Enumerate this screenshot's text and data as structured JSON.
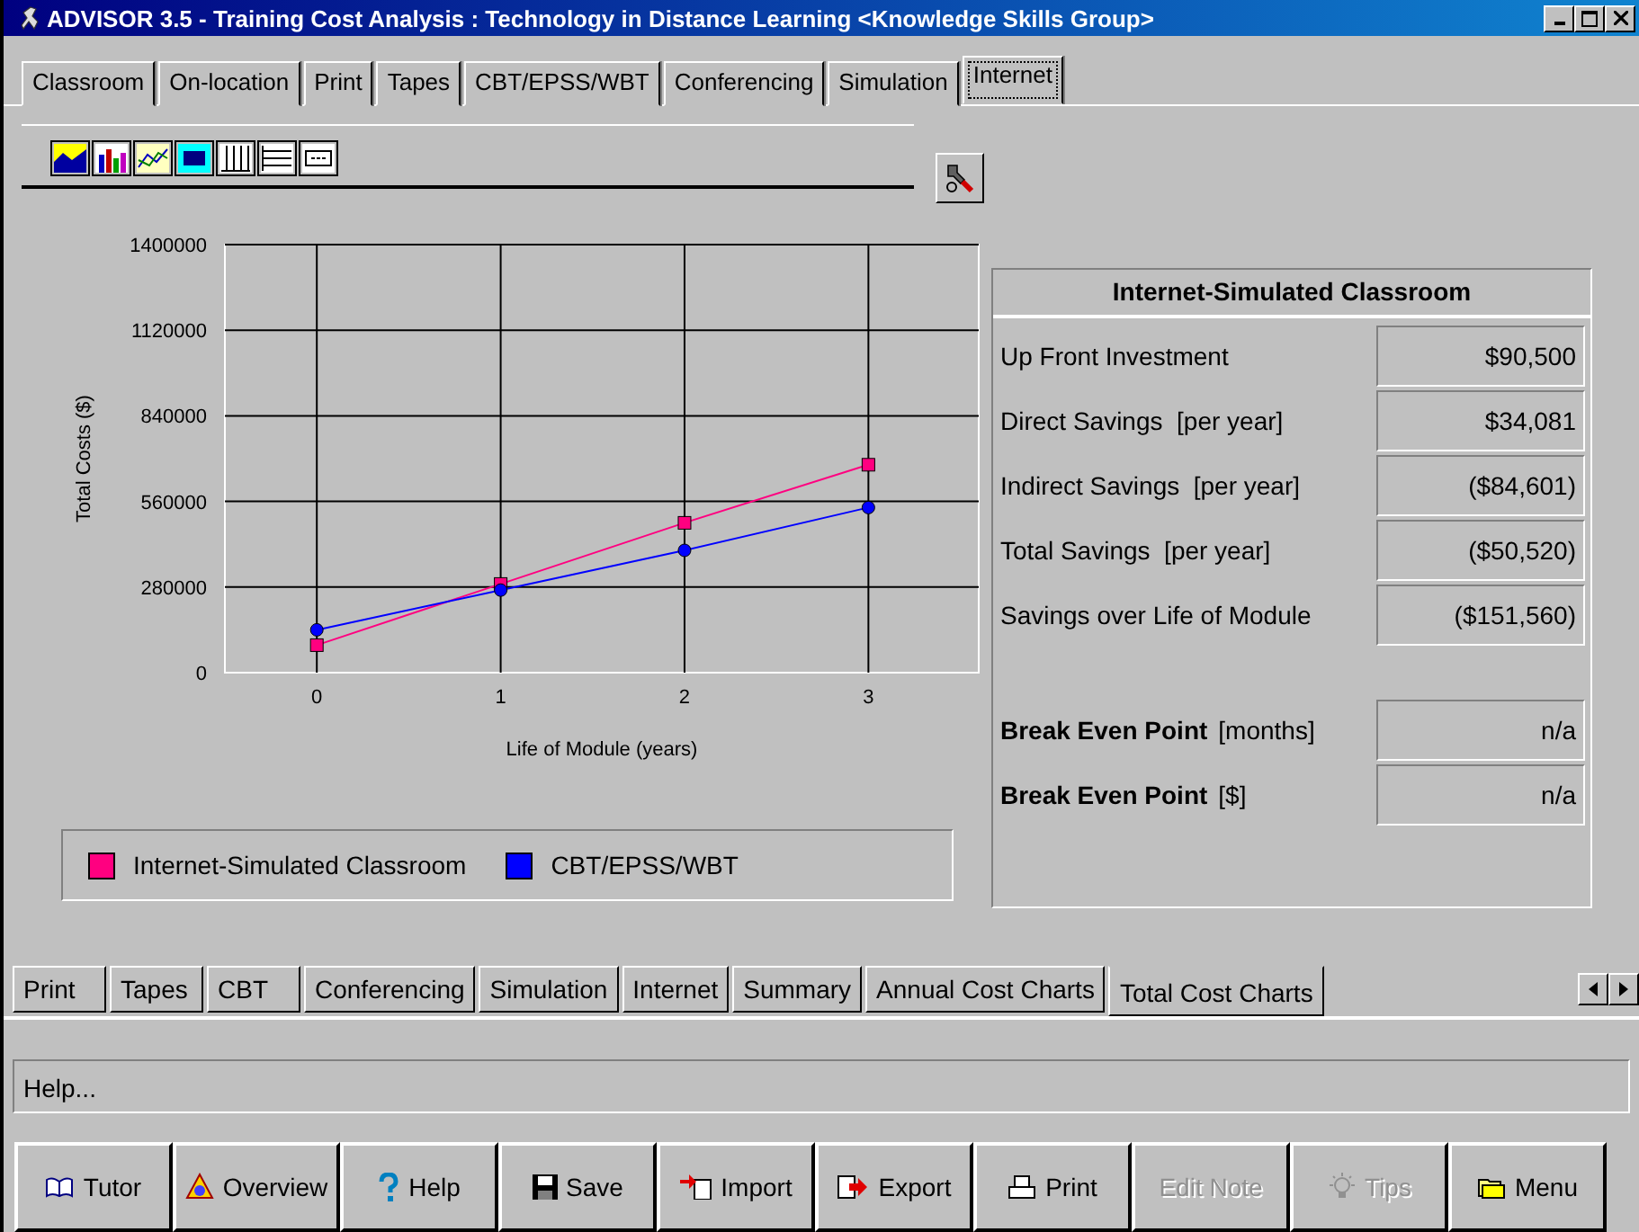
{
  "window": {
    "title": "ADVISOR 3.5 - Training Cost Analysis : Technology in Distance Learning <Knowledge Skills Group>"
  },
  "top_tabs": [
    {
      "label": "Classroom",
      "selected": false
    },
    {
      "label": "On-location",
      "selected": false
    },
    {
      "label": "Print",
      "selected": false
    },
    {
      "label": "Tapes",
      "selected": false
    },
    {
      "label": "CBT/EPSS/WBT",
      "selected": false
    },
    {
      "label": "Conferencing",
      "selected": false
    },
    {
      "label": "Simulation",
      "selected": false
    },
    {
      "label": "Internet",
      "selected": true
    }
  ],
  "chart": {
    "chart_data": {
      "type": "line",
      "grid": true,
      "legend": "bottom",
      "xlabel": "Life of Module (years)",
      "ylabel": "Total Costs ($)",
      "x": [
        0,
        1,
        2,
        3
      ],
      "xlim": [
        -0.5,
        3.6
      ],
      "ylim": [
        0,
        1400000
      ],
      "xticks": [
        0,
        1,
        2,
        3
      ],
      "yticks": [
        0,
        280000,
        560000,
        840000,
        1120000,
        1400000
      ],
      "series": [
        {
          "name": "Internet-Simulated Classroom",
          "color": "#ff0080",
          "marker": "square",
          "values": [
            90000,
            290000,
            490000,
            680000
          ]
        },
        {
          "name": "CBT/EPSS/WBT",
          "color": "#0000ff",
          "marker": "circle",
          "values": [
            140000,
            270000,
            400000,
            540000
          ]
        }
      ]
    }
  },
  "summary": {
    "title": "Internet-Simulated Classroom",
    "rows": [
      {
        "label": "Up Front Investment",
        "value": "$90,500"
      },
      {
        "label": "Direct Savings  [per year]",
        "value": "$34,081"
      },
      {
        "label": "Indirect Savings  [per year]",
        "value": "($84,601)"
      },
      {
        "label": "Total Savings  [per year]",
        "value": "($50,520)"
      },
      {
        "label": "Savings over Life of Module",
        "value": "($151,560)"
      }
    ],
    "break_even": [
      {
        "label": "Break Even Point",
        "unit": "[months]",
        "value": "n/a"
      },
      {
        "label": "Break Even Point",
        "unit": "[$]",
        "value": "n/a"
      }
    ]
  },
  "bottom_tabs": [
    {
      "label": "Print",
      "selected": false
    },
    {
      "label": "Tapes",
      "selected": false
    },
    {
      "label": "CBT",
      "selected": false
    },
    {
      "label": "Conferencing",
      "selected": false
    },
    {
      "label": "Simulation",
      "selected": false
    },
    {
      "label": "Internet",
      "selected": false
    },
    {
      "label": "Summary",
      "selected": false
    },
    {
      "label": "Annual Cost Charts",
      "selected": false
    },
    {
      "label": "Total Cost Charts",
      "selected": true
    }
  ],
  "help_bar": {
    "text": "Help..."
  },
  "buttons": [
    {
      "label": "Tutor",
      "kind": "book",
      "disabled": false
    },
    {
      "label": "Overview",
      "kind": "overview",
      "disabled": false
    },
    {
      "label": "Help",
      "kind": "help",
      "disabled": false
    },
    {
      "label": "Save",
      "kind": "save",
      "disabled": false
    },
    {
      "label": "Import",
      "kind": "import",
      "disabled": false
    },
    {
      "label": "Export",
      "kind": "export",
      "disabled": false
    },
    {
      "label": "Print",
      "kind": "print",
      "disabled": false
    },
    {
      "label": "Edit Note",
      "kind": "none",
      "disabled": true
    },
    {
      "label": "Tips",
      "kind": "tips",
      "disabled": true
    },
    {
      "label": "Menu",
      "kind": "menu",
      "disabled": false
    }
  ]
}
